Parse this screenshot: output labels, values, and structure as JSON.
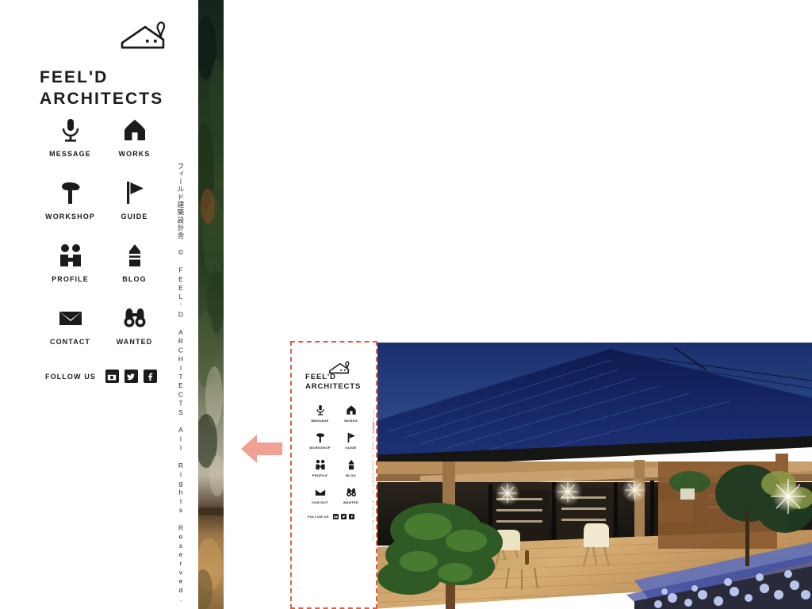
{
  "site": {
    "brand_line1": "FEEL'D",
    "brand_line2": "ARCHITECTS",
    "brand_full": "FEEL'D\nARCHITECTS",
    "logo_icon": "house-with-chimney-smoke-icon",
    "copyright_vertical": "フィールド建築設計舎 © FEEL'D ARCHITECTS All Rights Reserved.",
    "accent_dashed": "#e05d42",
    "accent_arrow": "#f0a094",
    "ink": "#1b1b1b"
  },
  "nav": {
    "items": [
      {
        "label": "MESSAGE",
        "icon": "microphone-icon"
      },
      {
        "label": "WORKS",
        "icon": "house-icon"
      },
      {
        "label": "WORKSHOP",
        "icon": "hammer-icon"
      },
      {
        "label": "GUIDE",
        "icon": "flag-icon"
      },
      {
        "label": "PROFILE",
        "icon": "people-icon"
      },
      {
        "label": "BLOG",
        "icon": "pencil-icon"
      },
      {
        "label": "CONTACT",
        "icon": "envelope-icon"
      },
      {
        "label": "WANTED",
        "icon": "binoculars-icon"
      }
    ]
  },
  "follow": {
    "label": "FOLLOW US",
    "socials": [
      {
        "name": "instagram-icon"
      },
      {
        "name": "twitter-icon"
      },
      {
        "name": "facebook-icon"
      }
    ]
  },
  "preview": {
    "arrow_icon": "arrow-left-icon",
    "frame_style": "dashed-highlight",
    "photo_alt": "Japanese house at dusk with blue tiled roof, wooden deck, white chairs and lit interior"
  }
}
